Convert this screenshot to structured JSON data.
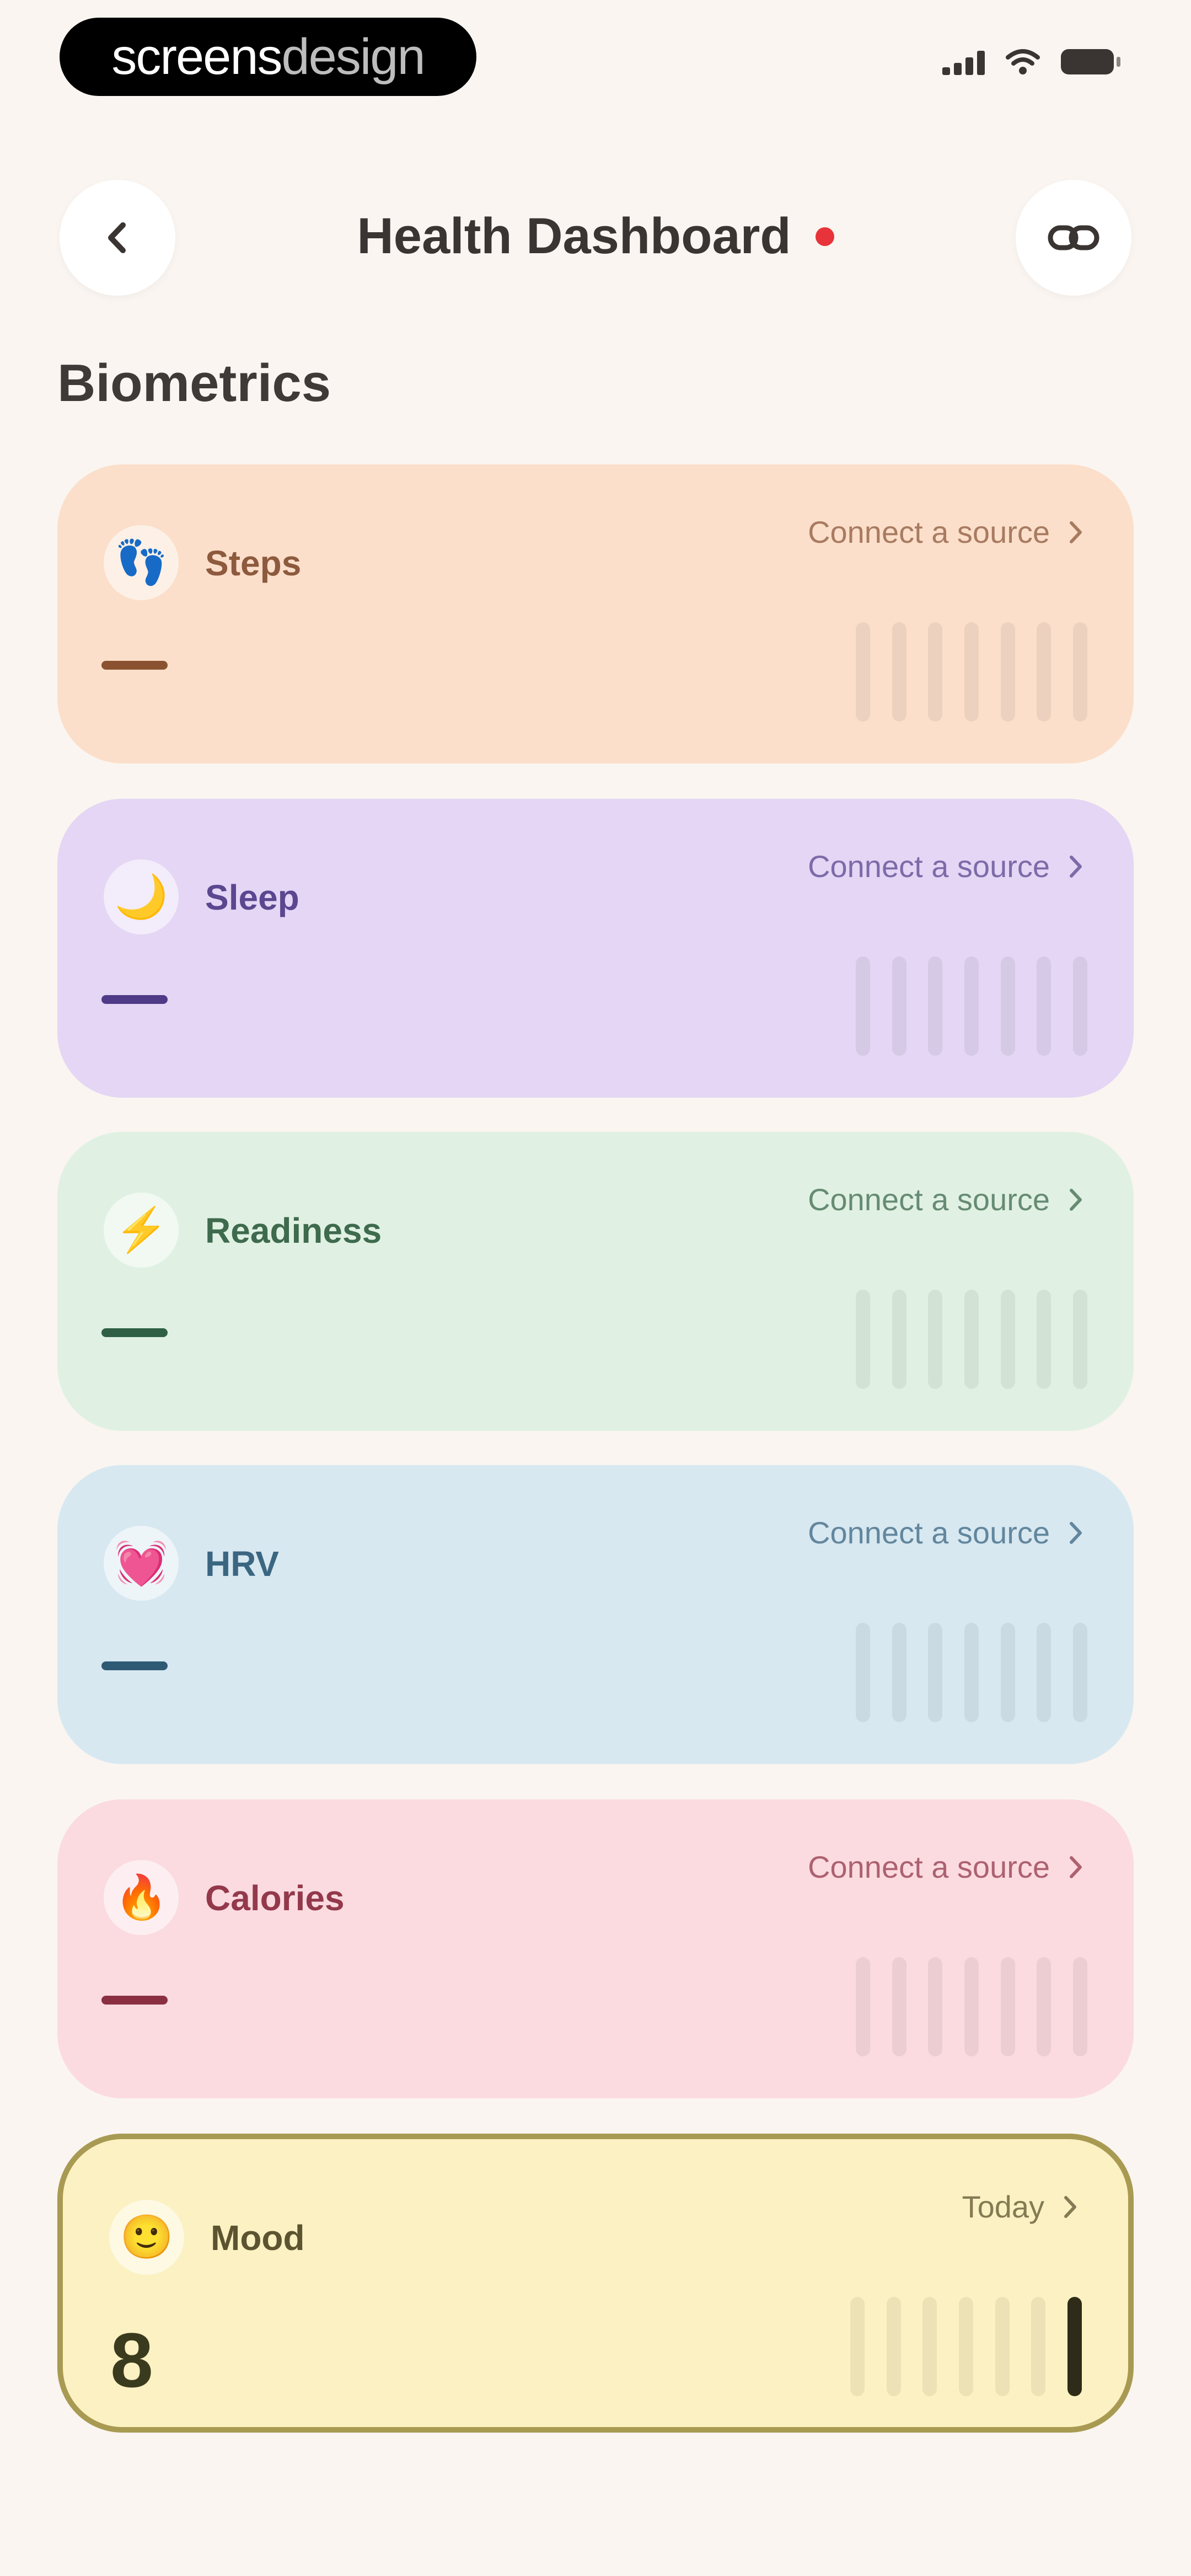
{
  "watermark": {
    "bold": "screens",
    "light": "design"
  },
  "header": {
    "title": "Health Dashboard"
  },
  "section": {
    "title": "Biometrics"
  },
  "cards": [
    {
      "label": "Steps",
      "link": "Connect a source",
      "value": "",
      "bg": "#fbdfca",
      "accent": "#8a5230",
      "text": "#8d5a3e",
      "icon": "footprints-icon",
      "glyph": "👣"
    },
    {
      "label": "Sleep",
      "link": "Connect a source",
      "value": "",
      "bg": "#e4d6f4",
      "accent": "#4f3a87",
      "text": "#5b4790",
      "icon": "moon-icon",
      "glyph": "🌙"
    },
    {
      "label": "Readiness",
      "link": "Connect a source",
      "value": "",
      "bg": "#e0f1e3",
      "accent": "#2f6045",
      "text": "#3e6a4d",
      "icon": "lightning-icon",
      "glyph": "⚡"
    },
    {
      "label": "HRV",
      "link": "Connect a source",
      "value": "",
      "bg": "#d7e8f1",
      "accent": "#2f5a74",
      "text": "#3b6681",
      "icon": "heart-rate-icon",
      "glyph": "💓"
    },
    {
      "label": "Calories",
      "link": "Connect a source",
      "value": "",
      "bg": "#fbdbe0",
      "accent": "#8a2f41",
      "text": "#93394b",
      "icon": "flame-icon",
      "glyph": "🔥"
    },
    {
      "label": "Mood",
      "link": "Today",
      "value": "8",
      "bg": "#fbf1c2",
      "accent": "#2e2b18",
      "text": "#5c5430",
      "icon": "smiley-icon",
      "glyph": "🙂"
    }
  ]
}
